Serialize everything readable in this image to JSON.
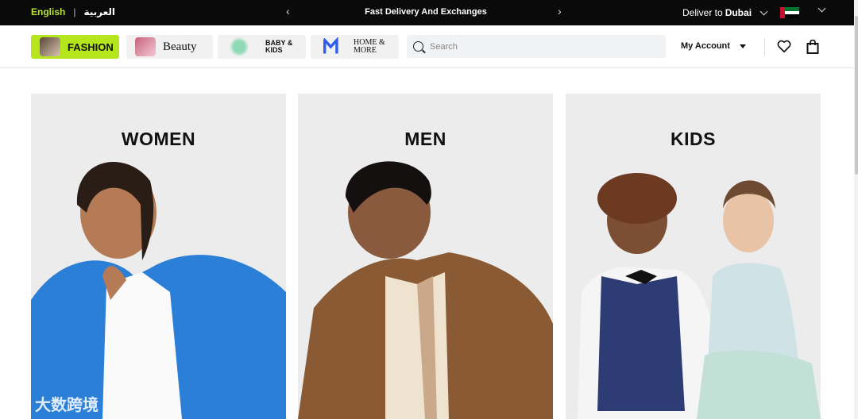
{
  "topbar": {
    "lang_en": "English",
    "lang_sep": "|",
    "lang_ar": "العربية",
    "promo_text": "Fast Delivery And Exchanges",
    "deliver_label": "Deliver to",
    "deliver_city": "Dubai",
    "flag_colors": {
      "red": "#c8102e",
      "green": "#00732f",
      "white": "#ffffff",
      "black": "#000000"
    }
  },
  "navbar": {
    "categories": [
      {
        "label": "FASHION",
        "icon": "fashion-thumbnail"
      },
      {
        "label": "Beauty",
        "icon": "beauty-thumbnail"
      },
      {
        "label": "BABY & KIDS",
        "icon": "baby-kids-thumbnail"
      },
      {
        "label": "HOME & MORE",
        "icon": "home-more-logo"
      }
    ],
    "search_placeholder": "Search",
    "account_label": "My Account",
    "wishlist_icon": "heart-icon",
    "bag_icon": "shopping-bag-icon",
    "accent_color": "#b5e61d"
  },
  "tiles": [
    {
      "title": "WOMEN"
    },
    {
      "title": "MEN"
    },
    {
      "title": "KIDS"
    }
  ],
  "watermark": {
    "text": "大数跨境"
  }
}
